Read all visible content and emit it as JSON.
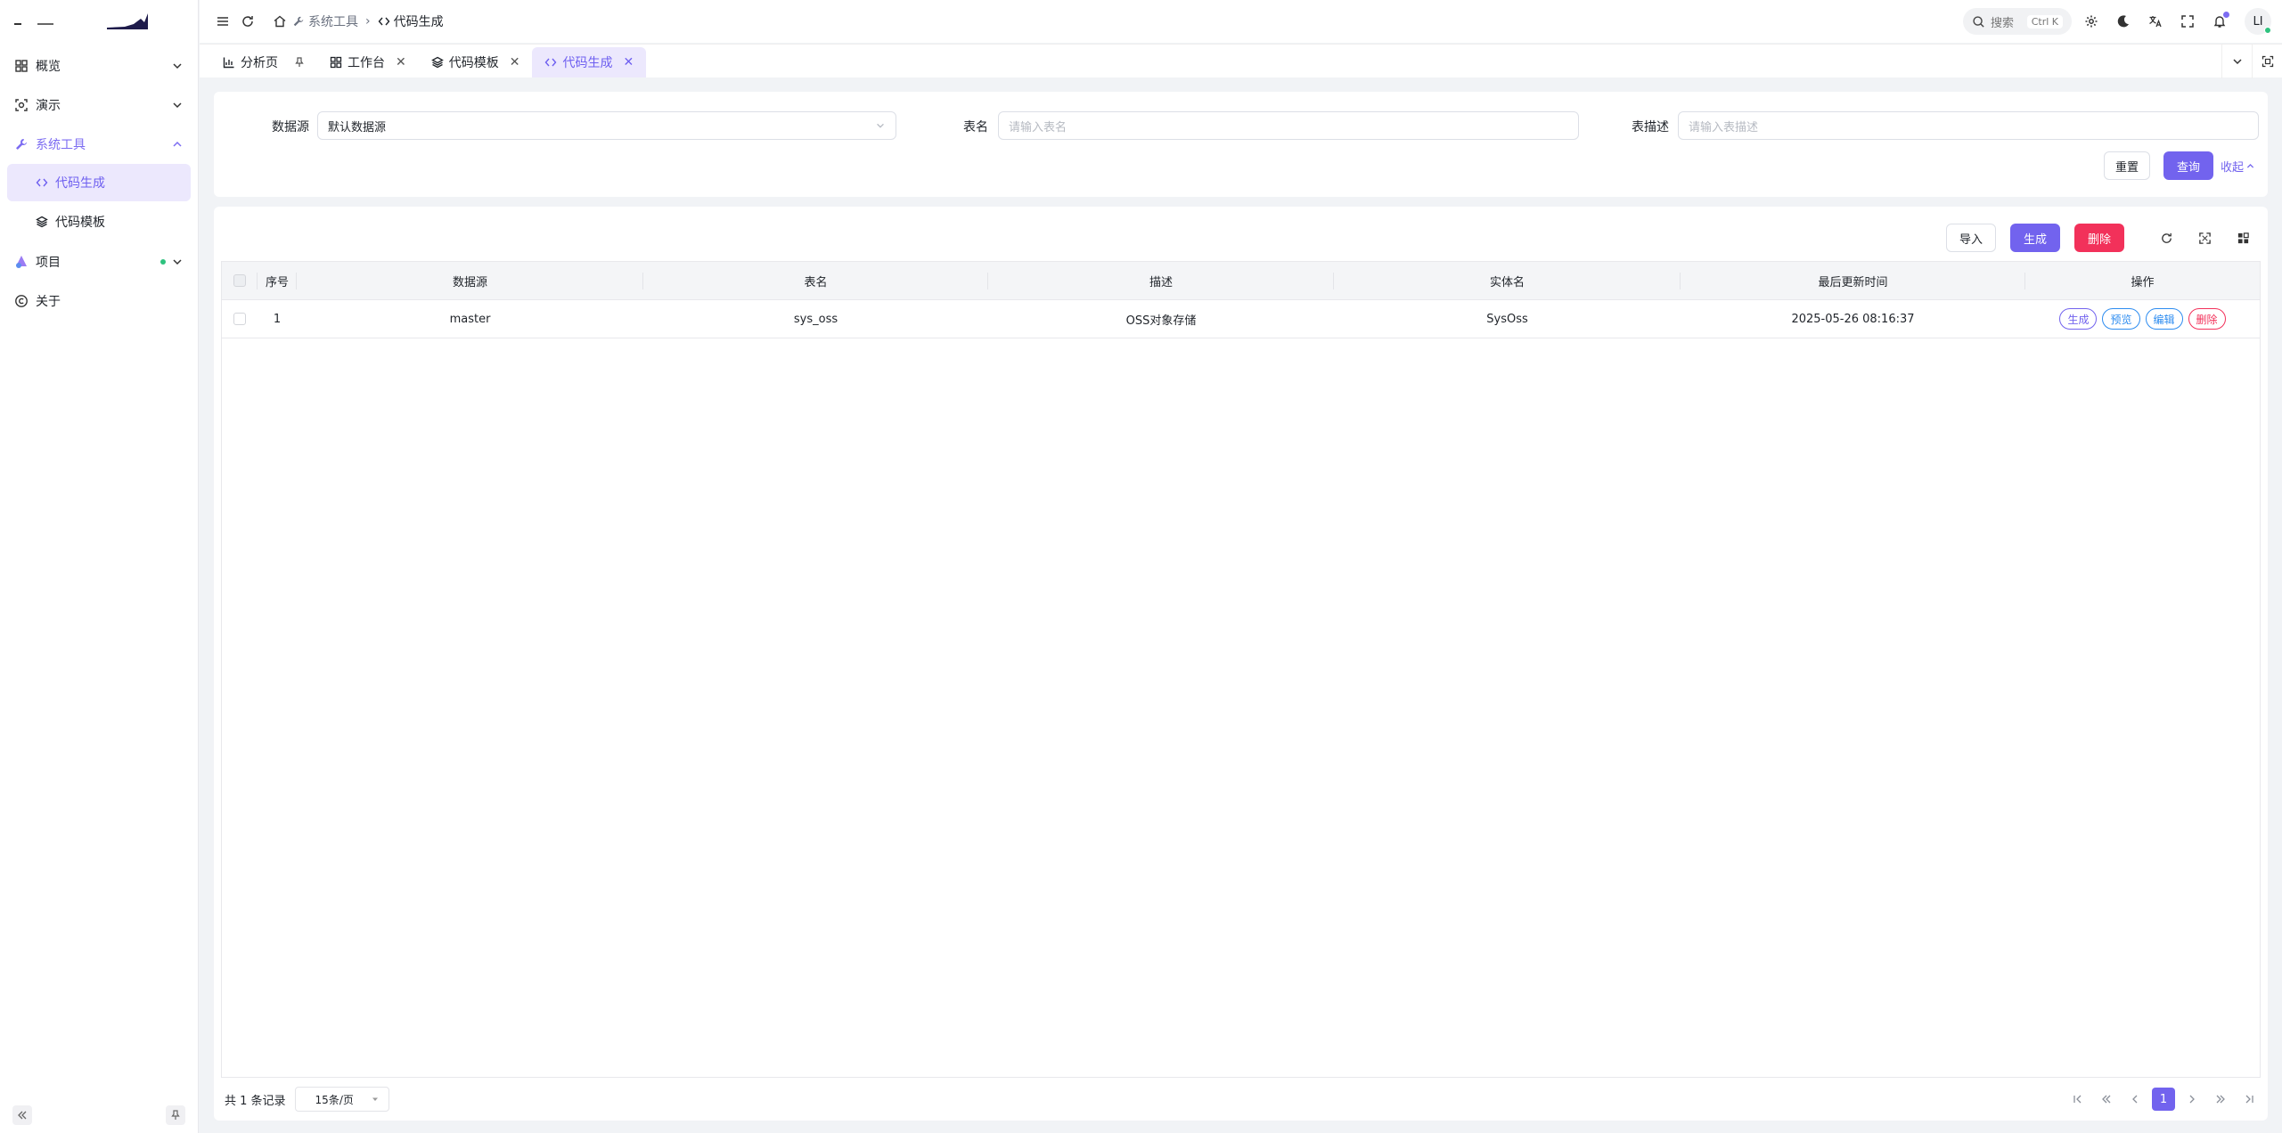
{
  "sidebar": {
    "items": [
      {
        "label": "概览",
        "icon": "dashboard-icon"
      },
      {
        "label": "演示",
        "icon": "demo-icon"
      },
      {
        "label": "系统工具",
        "icon": "wrench-icon"
      },
      {
        "label": "项目",
        "icon": "project-icon"
      },
      {
        "label": "关于",
        "icon": "copyright-icon"
      }
    ],
    "sub_items": [
      {
        "label": "代码生成",
        "icon": "code-icon"
      },
      {
        "label": "代码模板",
        "icon": "layers-icon"
      }
    ]
  },
  "header": {
    "breadcrumb": [
      "系统工具",
      "代码生成"
    ],
    "search_label": "搜索",
    "search_kbd": "Ctrl K",
    "avatar_text": "LI"
  },
  "tabs": [
    {
      "label": "分析页",
      "icon": "chart-icon"
    },
    {
      "label": "工作台",
      "icon": "grid-icon"
    },
    {
      "label": "代码模板",
      "icon": "layers-icon"
    },
    {
      "label": "代码生成",
      "icon": "code-icon"
    }
  ],
  "filter": {
    "datasource_label": "数据源",
    "datasource_value": "默认数据源",
    "tablename_label": "表名",
    "tablename_placeholder": "请输入表名",
    "tabledesc_label": "表描述",
    "tabledesc_placeholder": "请输入表描述",
    "reset_label": "重置",
    "query_label": "查询",
    "collapse_label": "收起"
  },
  "toolbar": {
    "import_label": "导入",
    "generate_label": "生成",
    "delete_label": "删除"
  },
  "table": {
    "columns": [
      "序号",
      "数据源",
      "表名",
      "描述",
      "实体名",
      "最后更新时间",
      "操作"
    ],
    "rows": [
      {
        "index": "1",
        "datasource": "master",
        "tablename": "sys_oss",
        "desc": "OSS对象存储",
        "entity": "SysOss",
        "updated": "2025-05-26 08:16:37"
      }
    ],
    "row_actions": [
      "生成",
      "预览",
      "编辑",
      "删除"
    ]
  },
  "pager": {
    "total_text": "共 1 条记录",
    "page_size": "15条/页",
    "current_page": "1"
  },
  "colors": {
    "accent": "#7263ee",
    "danger": "#f2315a",
    "info": "#2d8cf0",
    "active_bg": "#ece8fd"
  }
}
